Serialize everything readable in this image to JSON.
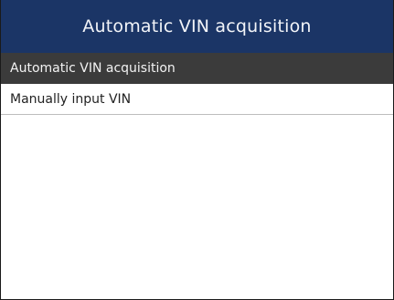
{
  "header": {
    "title": "Automatic VIN acquisition"
  },
  "menu": {
    "items": [
      {
        "label": "Automatic VIN acquisition",
        "selected": true
      },
      {
        "label": "Manually input VIN",
        "selected": false
      }
    ]
  },
  "colors": {
    "title_bar": "#1b3566",
    "selected_row": "#3b3b3b"
  }
}
